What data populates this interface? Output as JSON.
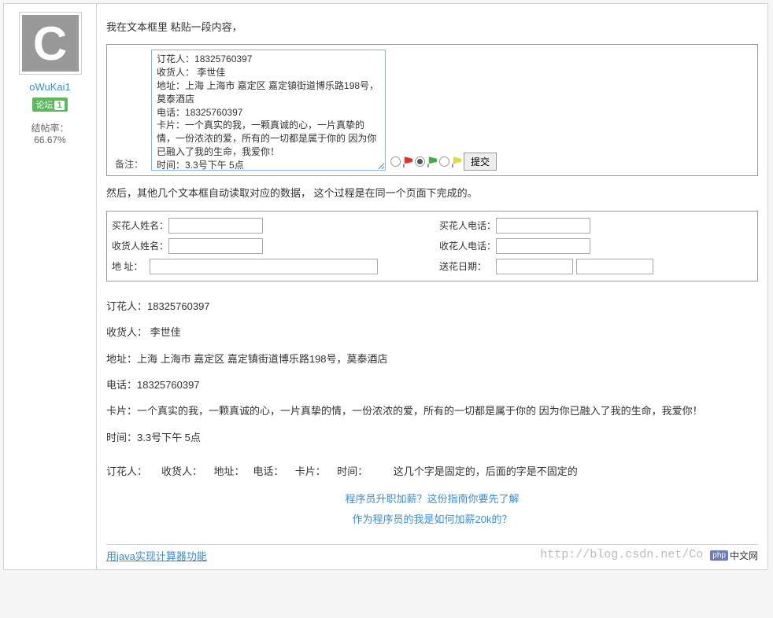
{
  "sidebar": {
    "username": "oWuKai1",
    "badge_label": "论坛",
    "badge_num": "1",
    "rate_label": "结帖率：",
    "rate_value": "66.67%"
  },
  "content": {
    "p1": "我在文本框里 粘贴一段内容，",
    "remark_label": "备注：",
    "textarea_value": "订花人：18325760397\n收货人： 李世佳\n地址：上海 上海市 嘉定区 嘉定镇街道博乐路198号，莫泰酒店\n电话：18325760397\n卡片：一个真实的我，一颗真诚的心，一片真挚的情，一份浓浓的爱，所有的一切都是属于你的 因为你已融入了我的生命，我爱你！\n时间：3.3号下午 5点",
    "submit_label": "提交",
    "p2": "然后，其他几个文本框自动读取对应的数据， 这个过程是在同一个页面下完成的。",
    "form": {
      "buyer_name": "买花人姓名：",
      "buyer_phone": "买花人电话：",
      "recv_name": "收货人姓名：",
      "recv_phone": "收花人电话：",
      "address": "地 址：",
      "date": "送花日期："
    },
    "lines": {
      "l1": "订花人：18325760397",
      "l2": "收货人： 李世佳",
      "l3": "地址：上海 上海市 嘉定区 嘉定镇街道博乐路198号，莫泰酒店",
      "l4": "电话：18325760397",
      "l5": "卡片：一个真实的我，一颗真诚的心，一片真挚的情，一份浓浓的爱，所有的一切都是属于你的 因为你已融入了我的生命，我爱你！",
      "l6": "时间：3.3号下午 5点"
    },
    "p3": "订花人：     收货人：    地址：   电话：    卡片：    时间：         这几个字是固定的，后面的字是不固定的",
    "promo1": "程序员升职加薪？这份指南你要先了解",
    "promo2": "作为程序员的我是如何加薪20k的？",
    "bottom_link": "用java实现计算器功能",
    "watermark_url": "http://blog.csdn.net/Co",
    "watermark_php": "php",
    "watermark_cn": "中文网"
  }
}
